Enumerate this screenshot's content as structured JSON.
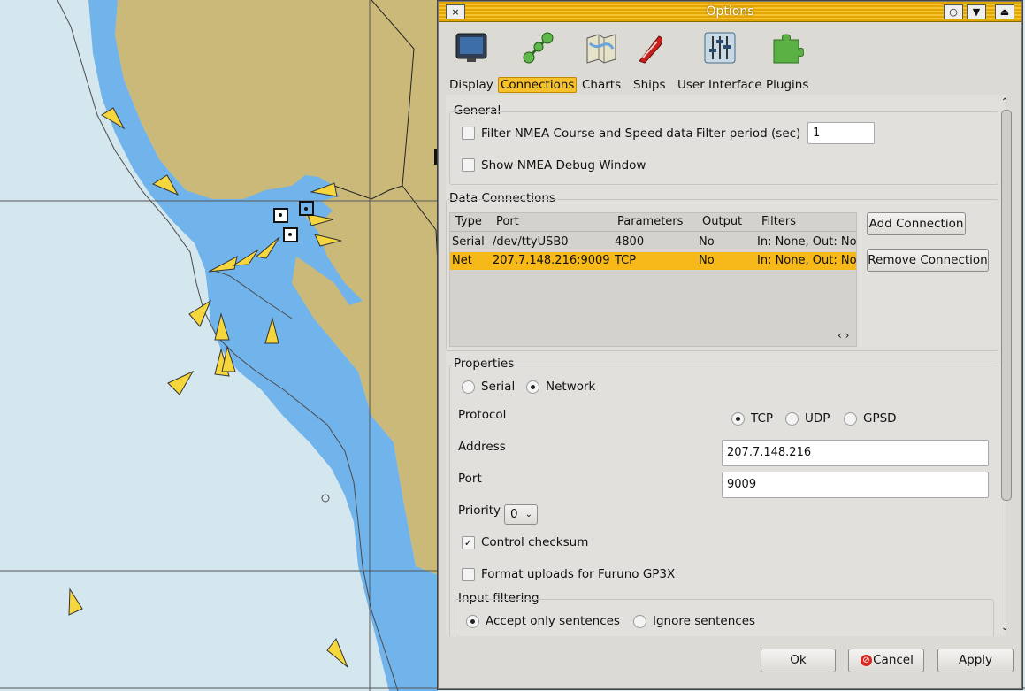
{
  "dialog": {
    "title": "Options",
    "title_buttons": {
      "close": "×",
      "restore": "○",
      "minimize": "▼",
      "shade": "⏏"
    }
  },
  "toolbar": {
    "tabs": [
      {
        "label": "Display",
        "icon": "display-icon"
      },
      {
        "label": "Connections",
        "icon": "connections-icon",
        "active": true
      },
      {
        "label": "Charts",
        "icon": "charts-icon"
      },
      {
        "label": "Ships",
        "icon": "ships-icon"
      },
      {
        "label": "User Interface",
        "icon": "user-interface-icon"
      },
      {
        "label": "Plugins",
        "icon": "plugins-icon"
      }
    ]
  },
  "general": {
    "title": "General",
    "filter_nmea_label": "Filter NMEA Course and Speed data",
    "filter_nmea_checked": false,
    "filter_period_label": "Filter period (sec)",
    "filter_period_value": "1",
    "show_debug_label": "Show NMEA Debug Window",
    "show_debug_checked": false
  },
  "data_connections": {
    "title": "Data Connections",
    "columns": [
      "Type",
      "Port",
      "Parameters",
      "Output",
      "Filters"
    ],
    "rows": [
      {
        "type": "Serial",
        "port": "/dev/ttyUSB0",
        "parameters": "4800",
        "output": "No",
        "filters": "In: None, Out: No",
        "selected": false
      },
      {
        "type": "Net",
        "port": "207.7.148.216:9009",
        "parameters": "TCP",
        "output": "No",
        "filters": "In: None, Out: No",
        "selected": true
      }
    ],
    "add_button": "Add Connection",
    "remove_button": "Remove Connection"
  },
  "properties": {
    "title": "Properties",
    "mode_serial": "Serial",
    "mode_network": "Network",
    "selected_mode": "Network",
    "protocol_label": "Protocol",
    "protocol_options": [
      "TCP",
      "UDP",
      "GPSD"
    ],
    "selected_protocol": "TCP",
    "address_label": "Address",
    "address_value": "207.7.148.216",
    "port_label": "Port",
    "port_value": "9009",
    "priority_label": "Priority",
    "priority_value": "0",
    "control_checksum_label": "Control checksum",
    "control_checksum_checked": true,
    "furuno_label": "Format uploads for Furuno GP3X",
    "furuno_checked": false,
    "input_filtering_title": "Input filtering",
    "accept_label": "Accept only sentences",
    "ignore_label": "Ignore sentences",
    "selected_filtering": "accept"
  },
  "buttons": {
    "ok": "Ok",
    "cancel": "Cancel",
    "apply": "Apply"
  },
  "colors": {
    "land": "#cbb97a",
    "shallow_water": "#71b3eb",
    "deep_water": "#d4e7ef",
    "ais_target": "#f5d63c",
    "accent": "#f7b91a"
  }
}
